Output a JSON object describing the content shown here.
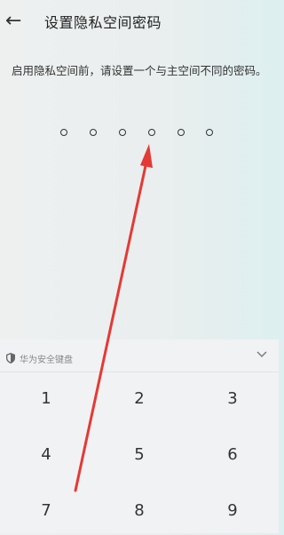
{
  "header": {
    "back_icon": "arrow-left-icon",
    "title": "设置隐私空间密码"
  },
  "instruction": "启用隐私空间前，请设置一个与主空间不同的密码。",
  "pin": {
    "length": 6,
    "entered": 0
  },
  "keyboard": {
    "name": "华为安全键盘",
    "shield_icon": "shield-icon",
    "collapse_icon": "chevron-down-icon",
    "keys": [
      "1",
      "2",
      "3",
      "4",
      "5",
      "6",
      "7",
      "8",
      "9"
    ]
  },
  "annotation": {
    "color": "#e53935"
  }
}
